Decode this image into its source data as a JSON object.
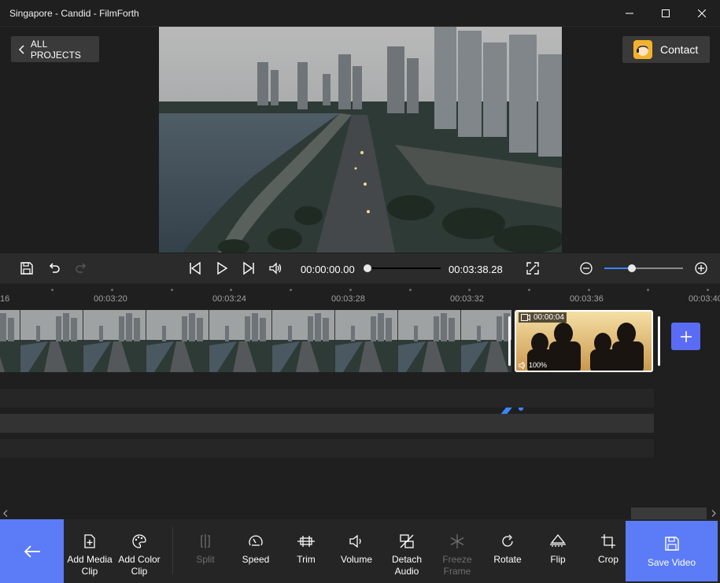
{
  "window": {
    "title": "Singapore - Candid - FilmForth"
  },
  "header": {
    "back_label": "ALL PROJECTS",
    "contact_label": "Contact"
  },
  "player": {
    "current_time": "00:00:00.00",
    "total_time": "00:03:38.28",
    "seek_progress": 0.0,
    "zoom_level": 0.35
  },
  "timeline": {
    "ruler_labels": [
      "16",
      "00:03:20",
      "00:03:24",
      "00:03:28",
      "00:03:32",
      "00:03:36",
      "00:03:40"
    ],
    "color_clip": {
      "duration": "00:00:04",
      "volume": "100%"
    }
  },
  "toolbar": {
    "add_media_line1": "Add Media",
    "add_media_line2": "Clip",
    "add_color_line1": "Add Color",
    "add_color_line2": "Clip",
    "split": "Split",
    "speed": "Speed",
    "trim": "Trim",
    "volume": "Volume",
    "detach_line1": "Detach",
    "detach_line2": "Audio",
    "freeze_line1": "Freeze",
    "freeze_line2": "Frame",
    "rotate": "Rotate",
    "flip": "Flip",
    "crop": "Crop",
    "save_video": "Save Video"
  },
  "colors": {
    "accent": "#5b7cf6",
    "annotation_arrow": "#3a86ff"
  }
}
